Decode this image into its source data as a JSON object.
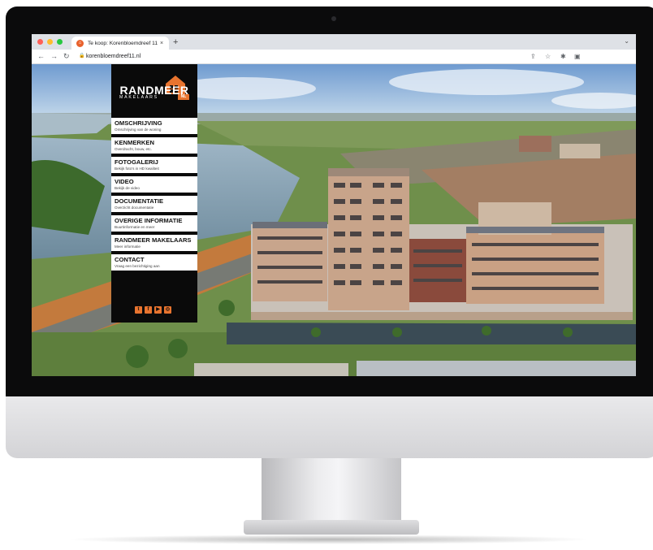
{
  "colors": {
    "accent": "#e8742f",
    "sidebar_bg": "#0a0a0a",
    "traffic_red": "#ff5f57",
    "traffic_yellow": "#febc2e",
    "traffic_green": "#28c840"
  },
  "browser": {
    "tab_title": "Te koop: Korenbloemdreef 11, …",
    "tab_close": "×",
    "new_tab": "+",
    "url": "korenbloemdreef11.nl",
    "icons": [
      "back-icon",
      "forward-icon",
      "reload-icon",
      "lock-icon",
      "share-icon",
      "star-icon",
      "extensions-icon",
      "sidepanel-icon",
      "chevron-down-icon"
    ]
  },
  "logo": {
    "main": "RANDMEER",
    "sub": "MAKELAARS",
    "badge": "NL"
  },
  "menu": [
    {
      "title": "OMSCHRIJVING",
      "sub": "Omschrijving van de woning"
    },
    {
      "title": "KENMERKEN",
      "sub": "Overdracht, bouw, etc."
    },
    {
      "title": "FOTOGALERIJ",
      "sub": "Bekijk foto's in HD kwaliteit"
    },
    {
      "title": "VIDEO",
      "sub": "Bekijk de video"
    },
    {
      "title": "DOCUMENTATIE",
      "sub": "Overzicht documentatie"
    },
    {
      "title": "OVERIGE INFORMATIE",
      "sub": "Buurtinformatie en meer"
    },
    {
      "title": "RANDMEER MAKELAARS",
      "sub": "Meer informatie"
    },
    {
      "title": "CONTACT",
      "sub": "Vraag een bezichtiging aan"
    }
  ],
  "social": [
    "twitter-icon",
    "facebook-icon",
    "youtube-icon",
    "instagram-icon"
  ]
}
